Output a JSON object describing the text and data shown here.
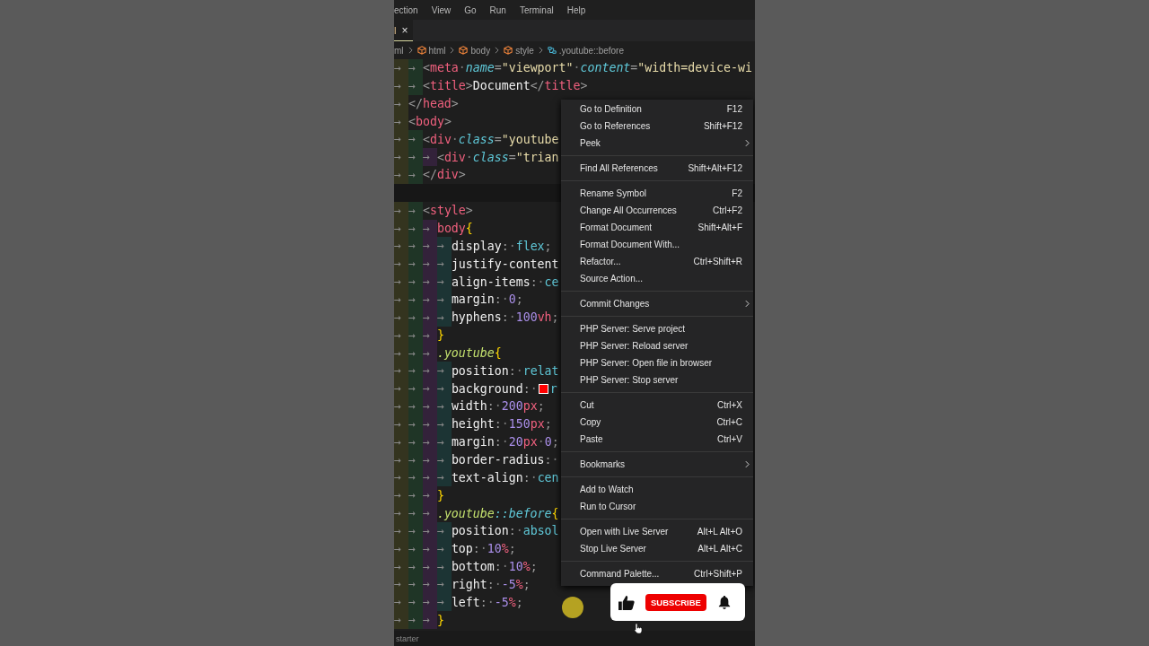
{
  "menu_bar": [
    "ection",
    "View",
    "Go",
    "Run",
    "Terminal",
    "Help"
  ],
  "tab": {
    "label": "l",
    "close": "×"
  },
  "breadcrumbs": [
    {
      "label": "ml",
      "kind": "file"
    },
    {
      "label": "html",
      "kind": "element"
    },
    {
      "label": "body",
      "kind": "element"
    },
    {
      "label": "style",
      "kind": "element"
    },
    {
      "label": ".youtube::before",
      "kind": "selector"
    }
  ],
  "code_lines": [
    {
      "indent": "→ → ",
      "tokens": [
        {
          "kind": "punct",
          "text": "<"
        },
        {
          "kind": "tag",
          "text": "meta"
        },
        {
          "kind": "space",
          "text": "·"
        },
        {
          "kind": "attr",
          "text": "name"
        },
        {
          "kind": "punct",
          "text": "="
        },
        {
          "kind": "string",
          "text": "\"viewport\""
        },
        {
          "kind": "space",
          "text": "·"
        },
        {
          "kind": "attr",
          "text": "content"
        },
        {
          "kind": "punct",
          "text": "="
        },
        {
          "kind": "string",
          "text": "\"width=device-wi"
        }
      ]
    },
    {
      "indent": "→ → ",
      "tokens": [
        {
          "kind": "punct",
          "text": "<"
        },
        {
          "kind": "tag",
          "text": "title"
        },
        {
          "kind": "punct",
          "text": ">"
        },
        {
          "kind": "text",
          "text": "Document"
        },
        {
          "kind": "punct",
          "text": "</"
        },
        {
          "kind": "tag",
          "text": "title"
        },
        {
          "kind": "punct",
          "text": ">"
        }
      ]
    },
    {
      "indent": "→ ",
      "tokens": [
        {
          "kind": "punct",
          "text": "</"
        },
        {
          "kind": "tag",
          "text": "head"
        },
        {
          "kind": "punct",
          "text": ">"
        }
      ]
    },
    {
      "indent": "→ ",
      "tokens": [
        {
          "kind": "punct",
          "text": "<"
        },
        {
          "kind": "tag",
          "text": "body"
        },
        {
          "kind": "punct",
          "text": ">"
        }
      ]
    },
    {
      "indent": "→ → ",
      "tokens": [
        {
          "kind": "punct",
          "text": "<"
        },
        {
          "kind": "tag",
          "text": "div"
        },
        {
          "kind": "space",
          "text": "·"
        },
        {
          "kind": "attr",
          "text": "class"
        },
        {
          "kind": "punct",
          "text": "="
        },
        {
          "kind": "string",
          "text": "\"youtube"
        }
      ]
    },
    {
      "indent": "→ → → ",
      "tokens": [
        {
          "kind": "punct",
          "text": "<"
        },
        {
          "kind": "tag",
          "text": "div"
        },
        {
          "kind": "space",
          "text": "·"
        },
        {
          "kind": "attr",
          "text": "class"
        },
        {
          "kind": "punct",
          "text": "="
        },
        {
          "kind": "string",
          "text": "\"trian"
        }
      ]
    },
    {
      "indent": "→ → ",
      "tokens": [
        {
          "kind": "punct",
          "text": "</"
        },
        {
          "kind": "tag",
          "text": "div"
        },
        {
          "kind": "punct",
          "text": ">"
        }
      ]
    },
    {
      "kind": "blank"
    },
    {
      "indent": "→ → ",
      "tokens": [
        {
          "kind": "punct",
          "text": "<"
        },
        {
          "kind": "tag",
          "text": "style"
        },
        {
          "kind": "punct",
          "text": ">"
        }
      ]
    },
    {
      "indent": "→ → → ",
      "tokens": [
        {
          "kind": "selector",
          "text": "body"
        },
        {
          "kind": "bracket",
          "text": "{"
        }
      ]
    },
    {
      "indent": "→ → → → ",
      "tokens": [
        {
          "kind": "property",
          "text": "display"
        },
        {
          "kind": "punct",
          "text": ":"
        },
        {
          "kind": "space",
          "text": "·"
        },
        {
          "kind": "value",
          "text": "flex"
        },
        {
          "kind": "punct",
          "text": ";"
        }
      ]
    },
    {
      "indent": "→ → → → ",
      "tokens": [
        {
          "kind": "property",
          "text": "justify-content"
        }
      ]
    },
    {
      "indent": "→ → → → ",
      "tokens": [
        {
          "kind": "property",
          "text": "align-items"
        },
        {
          "kind": "punct",
          "text": ":"
        },
        {
          "kind": "space",
          "text": "·"
        },
        {
          "kind": "value",
          "text": "ce"
        }
      ]
    },
    {
      "indent": "→ → → → ",
      "tokens": [
        {
          "kind": "property",
          "text": "margin"
        },
        {
          "kind": "punct",
          "text": ":"
        },
        {
          "kind": "space",
          "text": "·"
        },
        {
          "kind": "number",
          "text": "0"
        },
        {
          "kind": "punct",
          "text": ";"
        }
      ]
    },
    {
      "indent": "→ → → → ",
      "tokens": [
        {
          "kind": "property",
          "text": "hyphens"
        },
        {
          "kind": "punct",
          "text": ":"
        },
        {
          "kind": "space",
          "text": "·"
        },
        {
          "kind": "number",
          "text": "100"
        },
        {
          "kind": "unit",
          "text": "vh"
        },
        {
          "kind": "punct",
          "text": ";"
        }
      ]
    },
    {
      "indent": "→ → → ",
      "tokens": [
        {
          "kind": "bracket",
          "text": "}"
        }
      ]
    },
    {
      "indent": "→ → → ",
      "tokens": [
        {
          "kind": "class",
          "text": ".youtube"
        },
        {
          "kind": "bracket",
          "text": "{"
        }
      ]
    },
    {
      "indent": "→ → → → ",
      "tokens": [
        {
          "kind": "property",
          "text": "position"
        },
        {
          "kind": "punct",
          "text": ":"
        },
        {
          "kind": "space",
          "text": "·"
        },
        {
          "kind": "value",
          "text": "relat"
        }
      ]
    },
    {
      "indent": "→ → → → ",
      "tokens": [
        {
          "kind": "property",
          "text": "background"
        },
        {
          "kind": "punct",
          "text": ":"
        },
        {
          "kind": "space",
          "text": "·"
        },
        {
          "kind": "swatch",
          "color": "#ff0000"
        },
        {
          "kind": "value",
          "text": "r"
        }
      ]
    },
    {
      "indent": "→ → → → ",
      "tokens": [
        {
          "kind": "property",
          "text": "width"
        },
        {
          "kind": "punct",
          "text": ":"
        },
        {
          "kind": "space",
          "text": "·"
        },
        {
          "kind": "number",
          "text": "200"
        },
        {
          "kind": "unit",
          "text": "px"
        },
        {
          "kind": "punct",
          "text": ";"
        }
      ]
    },
    {
      "indent": "→ → → → ",
      "tokens": [
        {
          "kind": "property",
          "text": "height"
        },
        {
          "kind": "punct",
          "text": ":"
        },
        {
          "kind": "space",
          "text": "·"
        },
        {
          "kind": "number",
          "text": "150"
        },
        {
          "kind": "unit",
          "text": "px"
        },
        {
          "kind": "punct",
          "text": ";"
        }
      ]
    },
    {
      "indent": "→ → → → ",
      "tokens": [
        {
          "kind": "property",
          "text": "margin"
        },
        {
          "kind": "punct",
          "text": ":"
        },
        {
          "kind": "space",
          "text": "·"
        },
        {
          "kind": "number",
          "text": "20"
        },
        {
          "kind": "unit",
          "text": "px"
        },
        {
          "kind": "space",
          "text": "·"
        },
        {
          "kind": "number",
          "text": "0"
        },
        {
          "kind": "punct",
          "text": ";"
        }
      ]
    },
    {
      "indent": "→ → → → ",
      "tokens": [
        {
          "kind": "property",
          "text": "border-radius"
        },
        {
          "kind": "punct",
          "text": ":"
        },
        {
          "kind": "space",
          "text": "·"
        }
      ]
    },
    {
      "indent": "→ → → → ",
      "tokens": [
        {
          "kind": "property",
          "text": "text-align"
        },
        {
          "kind": "punct",
          "text": ":"
        },
        {
          "kind": "space",
          "text": "·"
        },
        {
          "kind": "value",
          "text": "cen"
        }
      ]
    },
    {
      "indent": "→ → → ",
      "tokens": [
        {
          "kind": "bracket",
          "text": "}"
        }
      ]
    },
    {
      "indent": "→ → → ",
      "tokens": [
        {
          "kind": "class",
          "text": ".youtube"
        },
        {
          "kind": "pseudo",
          "text": "::before"
        },
        {
          "kind": "bracket",
          "text": "{"
        }
      ]
    },
    {
      "indent": "→ → → → ",
      "tokens": [
        {
          "kind": "property",
          "text": "position"
        },
        {
          "kind": "punct",
          "text": ":"
        },
        {
          "kind": "space",
          "text": "·"
        },
        {
          "kind": "value",
          "text": "absol"
        }
      ]
    },
    {
      "indent": "→ → → → ",
      "tokens": [
        {
          "kind": "property",
          "text": "top"
        },
        {
          "kind": "punct",
          "text": ":"
        },
        {
          "kind": "space",
          "text": "·"
        },
        {
          "kind": "number",
          "text": "10"
        },
        {
          "kind": "unit",
          "text": "%"
        },
        {
          "kind": "punct",
          "text": ";"
        }
      ]
    },
    {
      "indent": "→ → → → ",
      "tokens": [
        {
          "kind": "property",
          "text": "bottom"
        },
        {
          "kind": "punct",
          "text": ":"
        },
        {
          "kind": "space",
          "text": "·"
        },
        {
          "kind": "number",
          "text": "10"
        },
        {
          "kind": "unit",
          "text": "%"
        },
        {
          "kind": "punct",
          "text": ";"
        }
      ]
    },
    {
      "indent": "→ → → → ",
      "tokens": [
        {
          "kind": "property",
          "text": "right"
        },
        {
          "kind": "punct",
          "text": ":"
        },
        {
          "kind": "space",
          "text": "·"
        },
        {
          "kind": "number",
          "text": "-5"
        },
        {
          "kind": "unit",
          "text": "%"
        },
        {
          "kind": "punct",
          "text": ";"
        }
      ]
    },
    {
      "indent": "→ → → → ",
      "tokens": [
        {
          "kind": "property",
          "text": "left"
        },
        {
          "kind": "punct",
          "text": ":"
        },
        {
          "kind": "space",
          "text": "·"
        },
        {
          "kind": "number",
          "text": "-5"
        },
        {
          "kind": "unit",
          "text": "%"
        },
        {
          "kind": "punct",
          "text": ";"
        }
      ]
    },
    {
      "indent": "→ → → ",
      "tokens": [
        {
          "kind": "bracket",
          "text": "}"
        }
      ]
    }
  ],
  "context_menu": {
    "groups": [
      [
        {
          "label": "Go to Definition",
          "shortcut": "F12",
          "submenu": false
        },
        {
          "label": "Go to References",
          "shortcut": "Shift+F12",
          "submenu": false
        },
        {
          "label": "Peek",
          "submenu": true
        }
      ],
      [
        {
          "label": "Find All References",
          "shortcut": "Shift+Alt+F12",
          "submenu": false
        }
      ],
      [
        {
          "label": "Rename Symbol",
          "shortcut": "F2",
          "submenu": false
        },
        {
          "label": "Change All Occurrences",
          "shortcut": "Ctrl+F2",
          "submenu": false
        },
        {
          "label": "Format Document",
          "shortcut": "Shift+Alt+F",
          "submenu": false
        },
        {
          "label": "Format Document With...",
          "submenu": false
        },
        {
          "label": "Refactor...",
          "shortcut": "Ctrl+Shift+R",
          "submenu": false
        },
        {
          "label": "Source Action...",
          "submenu": false
        }
      ],
      [
        {
          "label": "Commit Changes",
          "submenu": true
        }
      ],
      [
        {
          "label": "PHP Server: Serve project",
          "submenu": false
        },
        {
          "label": "PHP Server: Reload server",
          "submenu": false
        },
        {
          "label": "PHP Server: Open file in browser",
          "submenu": false
        },
        {
          "label": "PHP Server: Stop server",
          "submenu": false
        }
      ],
      [
        {
          "label": "Cut",
          "shortcut": "Ctrl+X",
          "submenu": false
        },
        {
          "label": "Copy",
          "shortcut": "Ctrl+C",
          "submenu": false
        },
        {
          "label": "Paste",
          "shortcut": "Ctrl+V",
          "submenu": false
        }
      ],
      [
        {
          "label": "Bookmarks",
          "submenu": true
        }
      ],
      [
        {
          "label": "Add to Watch",
          "submenu": false
        },
        {
          "label": "Run to Cursor",
          "submenu": false
        }
      ],
      [
        {
          "label": "Open with Live Server",
          "shortcut": "Alt+L Alt+O",
          "submenu": false
        },
        {
          "label": "Stop Live Server",
          "shortcut": "Alt+L Alt+C",
          "submenu": false
        }
      ],
      [
        {
          "label": "Command Palette...",
          "shortcut": "Ctrl+Shift+P",
          "submenu": false
        }
      ]
    ]
  },
  "subscribe_overlay": {
    "button": "SUBSCRIBE"
  },
  "status_bar": {
    "text": "starter"
  }
}
